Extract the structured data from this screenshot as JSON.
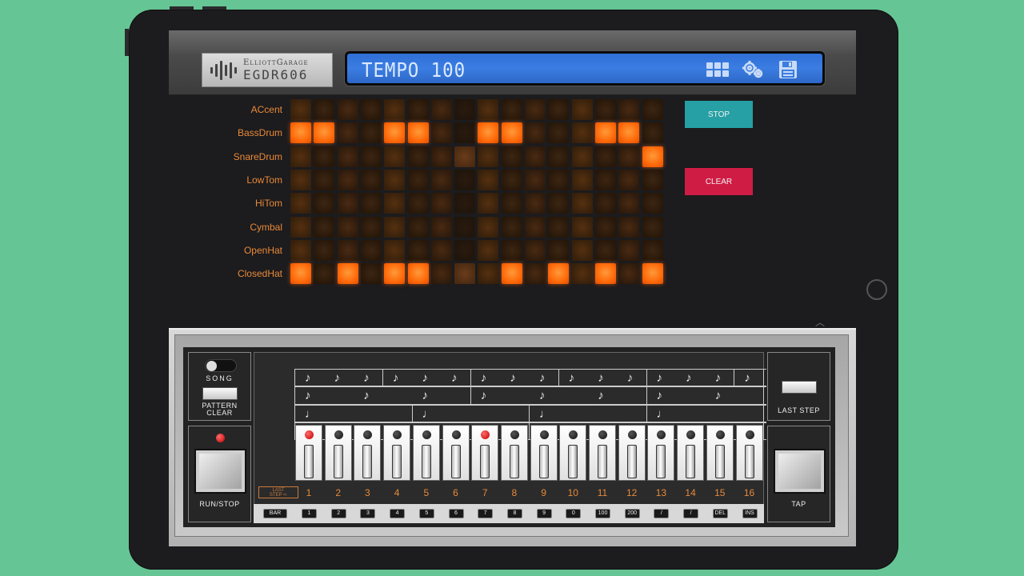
{
  "header": {
    "brand": "ElliottGarage",
    "model": "EGDR606",
    "lcd_text": "TEMPO 100",
    "lcd_icons": [
      "grid-icon",
      "gear-icon",
      "floppy-save-icon"
    ]
  },
  "rows": [
    {
      "label": "ACcent",
      "steps": [
        0,
        0,
        0,
        0,
        0,
        0,
        0,
        0,
        0,
        0,
        0,
        0,
        0,
        0,
        0,
        0
      ]
    },
    {
      "label": "BassDrum",
      "steps": [
        1,
        1,
        0,
        0,
        1,
        1,
        0,
        0,
        1,
        1,
        0,
        0,
        0,
        1,
        1,
        0
      ]
    },
    {
      "label": "SnareDrum",
      "steps": [
        0,
        0,
        0,
        0,
        0,
        0,
        0,
        0,
        0,
        0,
        0,
        0,
        0,
        0,
        0,
        1
      ]
    },
    {
      "label": "LowTom",
      "steps": [
        0,
        0,
        0,
        0,
        0,
        0,
        0,
        0,
        0,
        0,
        0,
        0,
        0,
        0,
        0,
        0
      ]
    },
    {
      "label": "HiTom",
      "steps": [
        0,
        0,
        0,
        0,
        0,
        0,
        0,
        0,
        0,
        0,
        0,
        0,
        0,
        0,
        0,
        0
      ]
    },
    {
      "label": "Cymbal",
      "steps": [
        0,
        0,
        0,
        0,
        0,
        0,
        0,
        0,
        0,
        0,
        0,
        0,
        0,
        0,
        0,
        0
      ]
    },
    {
      "label": "OpenHat",
      "steps": [
        0,
        0,
        0,
        0,
        0,
        0,
        0,
        0,
        0,
        0,
        0,
        0,
        0,
        0,
        0,
        0
      ]
    },
    {
      "label": "ClosedHat",
      "steps": [
        1,
        0,
        1,
        0,
        1,
        1,
        0,
        0,
        0,
        1,
        0,
        1,
        0,
        1,
        0,
        1
      ]
    }
  ],
  "controls": {
    "stop_label": "STOP",
    "clear_label": "CLEAR",
    "colors": {
      "stop": "#26a0a4",
      "clear": "#cf1c45",
      "active_step": "#ff7a1a",
      "label": "#e88a3a"
    }
  },
  "panel": {
    "song_label": "SONG",
    "pattern_clear_label": "PATTERN\nCLEAR",
    "run_stop_label": "RUN/STOP",
    "last_step_label": "LAST STEP",
    "tap_label": "TAP",
    "last_step_tag": "LAST\nSTEP",
    "step_numbers": [
      "1",
      "2",
      "3",
      "4",
      "5",
      "6",
      "7",
      "8",
      "9",
      "10",
      "11",
      "12",
      "13",
      "14",
      "15",
      "16"
    ],
    "step_leds": [
      1,
      0,
      0,
      0,
      0,
      0,
      1,
      0,
      0,
      0,
      0,
      0,
      0,
      0,
      0,
      0
    ],
    "bottom_keys": [
      "BAR",
      "1",
      "2",
      "3",
      "4",
      "5",
      "6",
      "7",
      "8",
      "9",
      "0",
      "100",
      "200",
      "/",
      "/",
      "DEL",
      "INS"
    ]
  }
}
